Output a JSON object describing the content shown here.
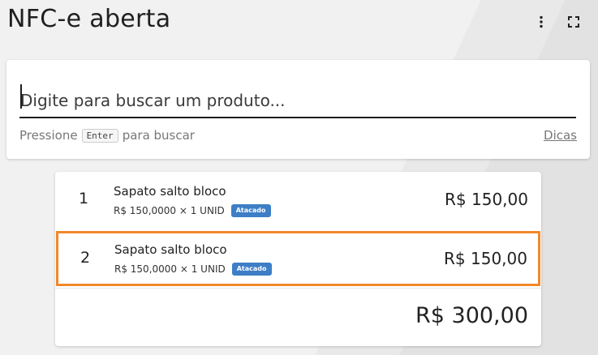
{
  "header": {
    "title": "NFC-e aberta",
    "more_icon": "more-vert-icon",
    "expand_icon": "fullscreen-icon"
  },
  "search": {
    "placeholder": "Digite para buscar um produto...",
    "value": "",
    "hint_before": "Pressione",
    "hint_key": "Enter",
    "hint_after": "para buscar",
    "tips_label": "Dicas"
  },
  "items": [
    {
      "number": "1",
      "name": "Sapato salto bloco",
      "detail": "R$ 150,0000 × 1 UNID",
      "badge": "Atacado",
      "total": "R$ 150,00",
      "selected": false
    },
    {
      "number": "2",
      "name": "Sapato salto bloco",
      "detail": "R$ 150,0000 × 1 UNID",
      "badge": "Atacado",
      "total": "R$ 150,00",
      "selected": true
    }
  ],
  "grand_total": "R$ 300,00",
  "colors": {
    "selection_border": "#f2882a",
    "badge_bg": "#3d7ec6"
  }
}
